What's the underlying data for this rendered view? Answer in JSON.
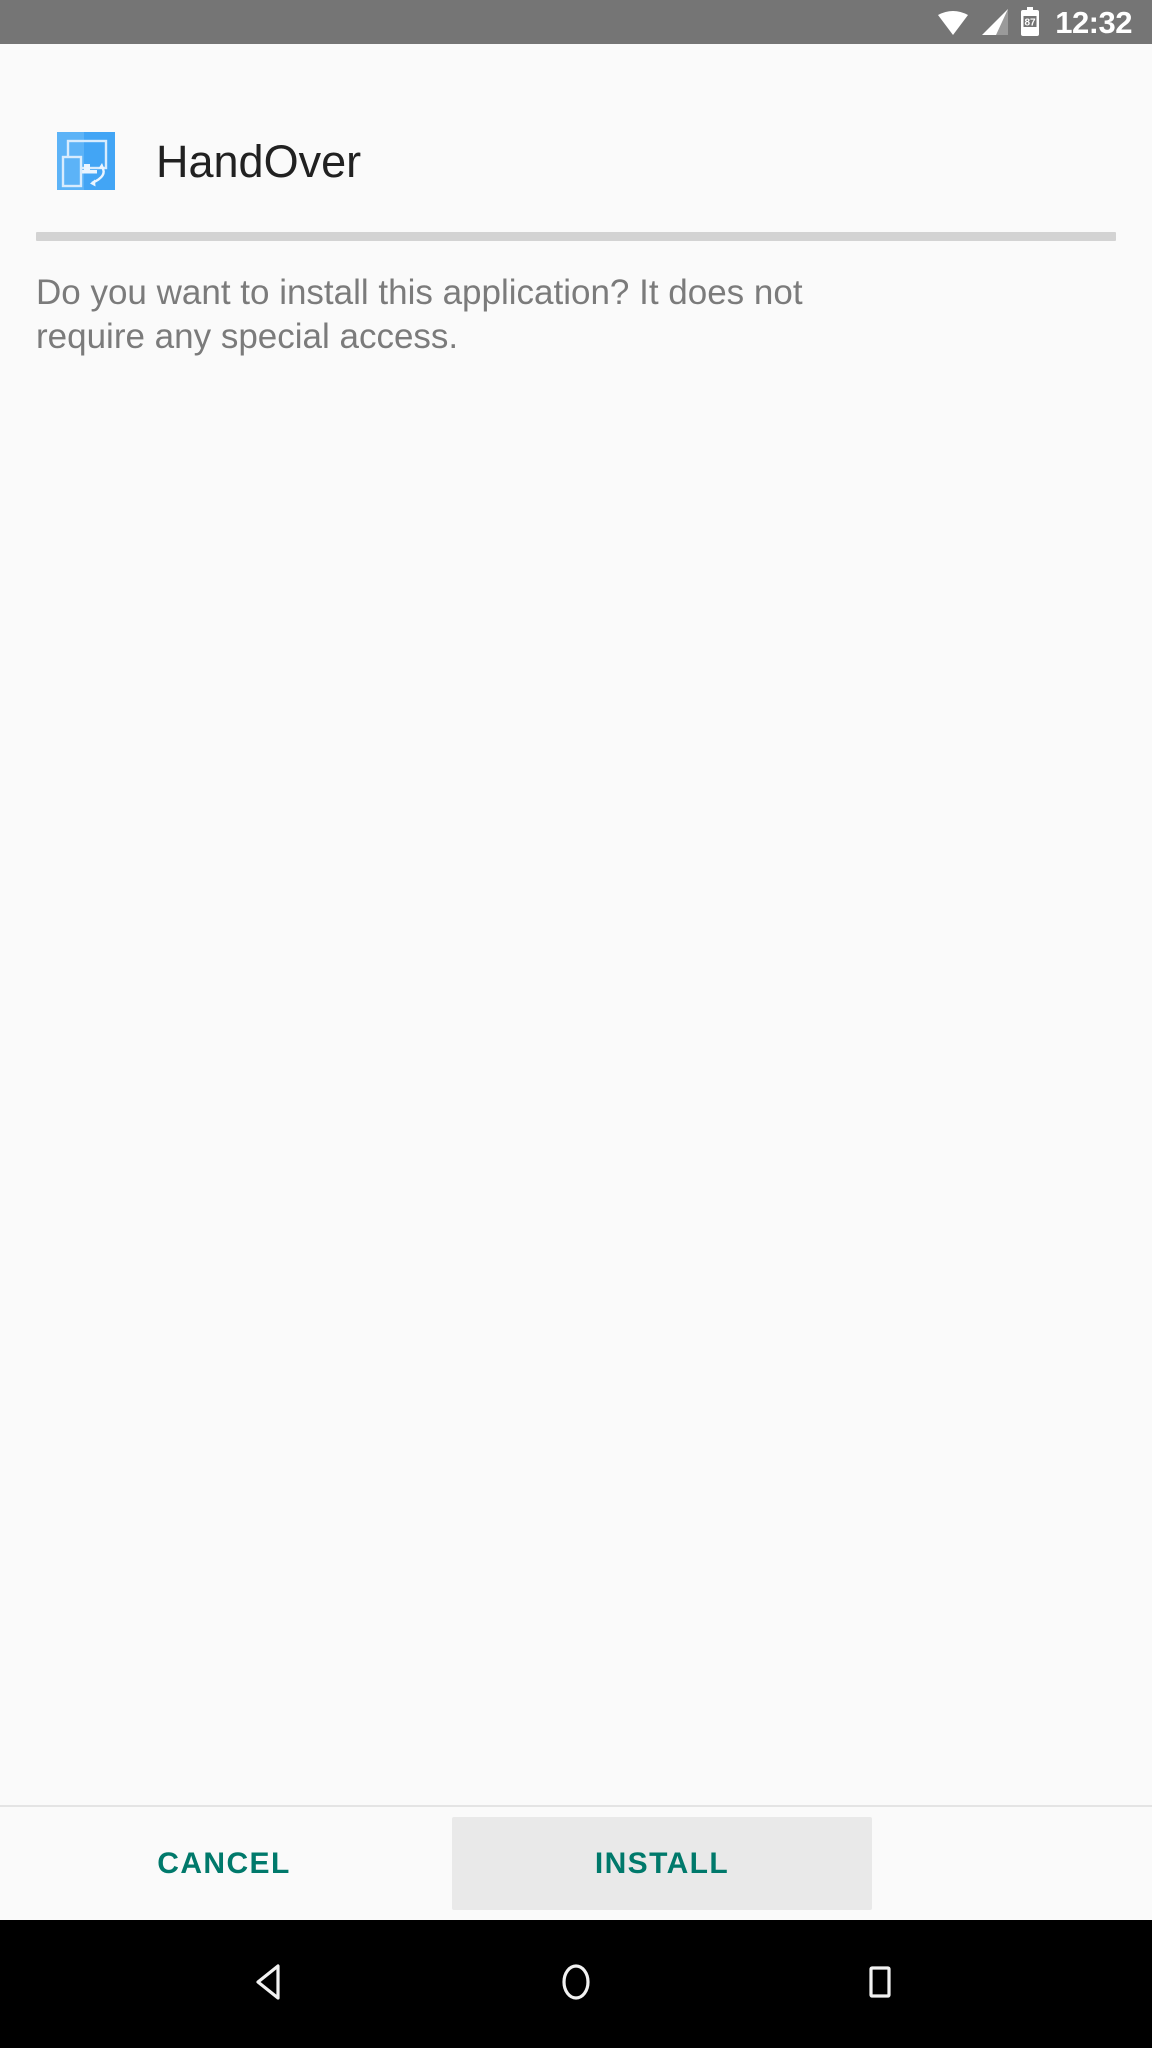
{
  "status_bar": {
    "background": "#757575",
    "time": "12:32",
    "battery_level": "87",
    "icons": [
      "wifi-icon",
      "signal-icon",
      "battery-icon"
    ]
  },
  "header": {
    "app_name": "HandOver",
    "icon": "handover-app-icon",
    "icon_color": "#42a5f5"
  },
  "content": {
    "prompt": "Do you want to install this application? It does not require any special access."
  },
  "buttons": {
    "cancel_label": "CANCEL",
    "install_label": "INSTALL",
    "accent_color": "#00796b",
    "install_background": "#e9e9e9"
  },
  "nav_bar": {
    "background": "#000000",
    "back_label": "back-icon",
    "home_label": "home-icon",
    "recents_label": "recents-icon"
  }
}
